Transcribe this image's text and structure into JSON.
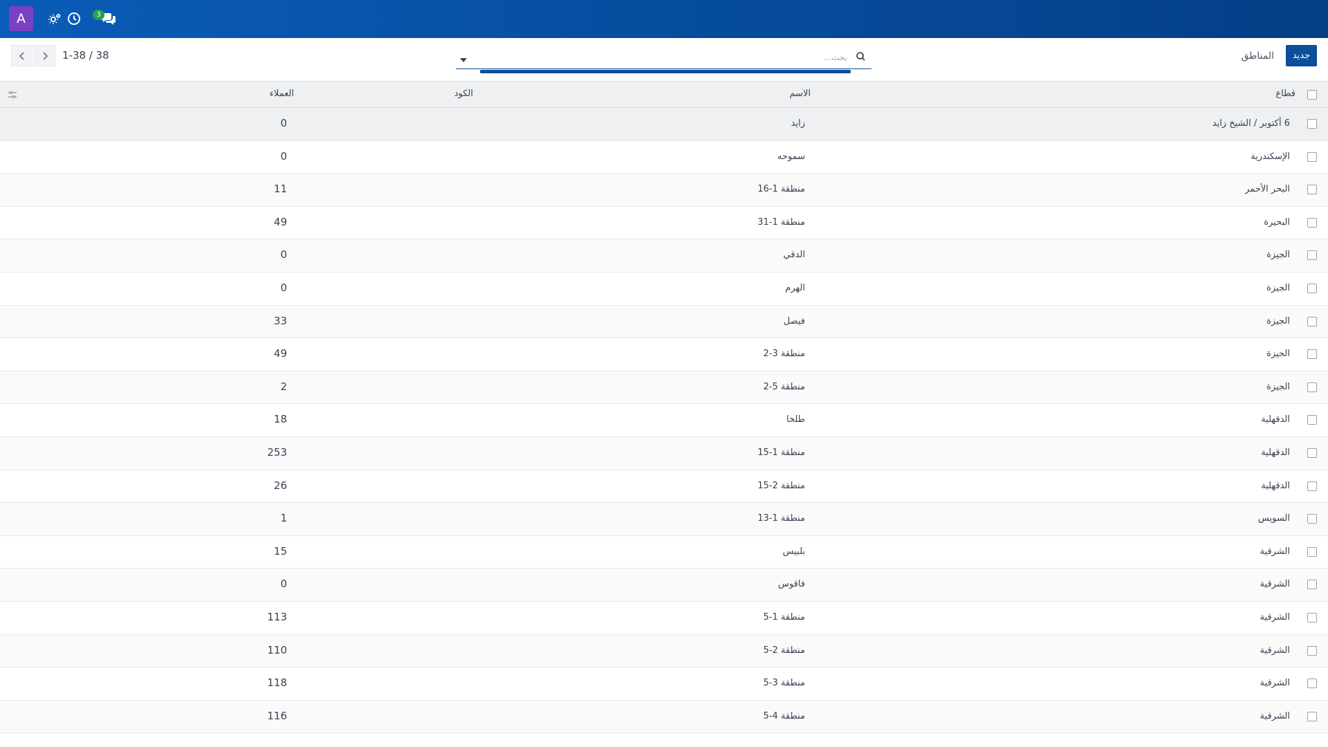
{
  "navbar": {
    "avatar_letter": "A",
    "icons": [
      "settings-gears-icon",
      "clock-icon",
      "chat-icon"
    ],
    "messages_count": "3"
  },
  "control": {
    "new_label": "جديد",
    "breadcrumb": "المناطق",
    "search": {
      "value": "",
      "placeholder": "بحث..."
    },
    "pager": "1-38 / 38"
  },
  "table": {
    "headers": {
      "sector": "قطاع",
      "name": "الاسم",
      "code": "الكود",
      "customers": "العملاء"
    },
    "rows": [
      {
        "sector": "6 أكتوبر / الشيخ زايد",
        "name": "زايد",
        "code": "",
        "customers": "0"
      },
      {
        "sector": "الإسكندرية",
        "name": "سموحه",
        "code": "",
        "customers": "0"
      },
      {
        "sector": "البحر الأحمر",
        "name": "منطقة 1-16",
        "code": "",
        "customers": "11"
      },
      {
        "sector": "البحيرة",
        "name": "منطقة 1-31",
        "code": "",
        "customers": "49"
      },
      {
        "sector": "الجيزة",
        "name": "الدقي",
        "code": "",
        "customers": "0"
      },
      {
        "sector": "الجيزة",
        "name": "الهرم",
        "code": "",
        "customers": "0"
      },
      {
        "sector": "الجيزة",
        "name": "فيصل",
        "code": "",
        "customers": "33"
      },
      {
        "sector": "الجيزة",
        "name": "منطقة 3-2",
        "code": "",
        "customers": "49"
      },
      {
        "sector": "الجيزة",
        "name": "منطقة 5-2",
        "code": "",
        "customers": "2"
      },
      {
        "sector": "الدقهلية",
        "name": "طلخا",
        "code": "",
        "customers": "18"
      },
      {
        "sector": "الدقهلية",
        "name": "منطقة 1-15",
        "code": "",
        "customers": "253"
      },
      {
        "sector": "الدقهلية",
        "name": "منطقة 2-15",
        "code": "",
        "customers": "26"
      },
      {
        "sector": "السويس",
        "name": "منطقة 1-13",
        "code": "",
        "customers": "1"
      },
      {
        "sector": "الشرقية",
        "name": "بلبيس",
        "code": "",
        "customers": "15"
      },
      {
        "sector": "الشرقية",
        "name": "فاقوس",
        "code": "",
        "customers": "0"
      },
      {
        "sector": "الشرقية",
        "name": "منطقة 1-5",
        "code": "",
        "customers": "113"
      },
      {
        "sector": "الشرقية",
        "name": "منطقة 2-5",
        "code": "",
        "customers": "110"
      },
      {
        "sector": "الشرقية",
        "name": "منطقة 3-5",
        "code": "",
        "customers": "118"
      },
      {
        "sector": "الشرقية",
        "name": "منطقة 4-5",
        "code": "",
        "customers": "116"
      }
    ]
  },
  "colors": {
    "navbar": "#0a5cb8",
    "primary": "#0b4e99",
    "avatar": "#7b3fc4",
    "badge": "#22a44a"
  }
}
